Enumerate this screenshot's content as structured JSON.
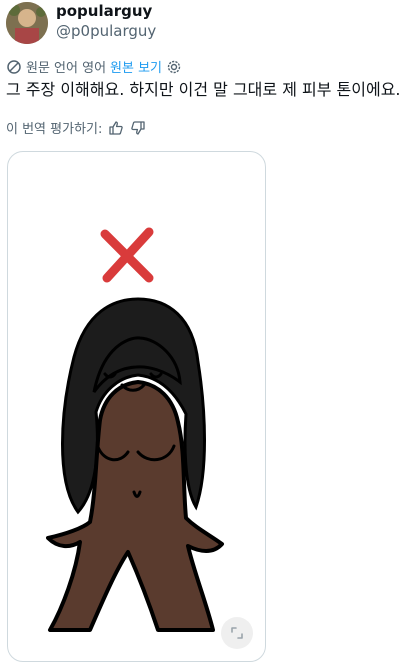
{
  "tweet": {
    "display_name": "popularguy",
    "handle": "@p0pularguy",
    "translation": {
      "source_label": "원문 언어 영어",
      "view_original_label": "원본 보기"
    },
    "text": "그 주장 이해해요. 하지만 이건 말 그대로 제 피부 톤이에요.",
    "rate_translation_label": "이 번역 평가하기:"
  },
  "icons": {
    "translate": "translate-icon",
    "settings": "gear-icon",
    "thumbs_up": "thumbs-up-icon",
    "thumbs_down": "thumbs-down-icon",
    "media_badge": "fullscreen-icon"
  },
  "colors": {
    "link": "#1d9bf0",
    "secondary_text": "#536471",
    "primary_text": "#0f1419",
    "border": "#cfd9de",
    "cross": "#d93b3b",
    "skin": "#5a3b2e",
    "hair": "#1c1c1c"
  }
}
